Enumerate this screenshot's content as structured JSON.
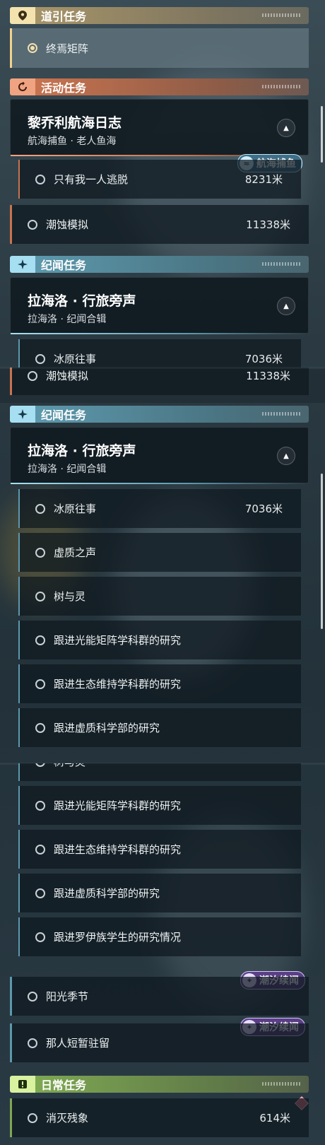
{
  "guide": {
    "category": "道引任务",
    "item": "终焉矩阵"
  },
  "activity": {
    "category": "活动任务",
    "title": "黎乔利航海日志",
    "subtitle": "航海捕鱼 · 老人鱼海",
    "tag": "航海捕鱼",
    "items": [
      {
        "label": "只有我一人逃脱",
        "distance": "8231米"
      },
      {
        "label": "潮蚀模拟",
        "distance": "11338米"
      }
    ]
  },
  "lore": {
    "category": "纪闻任务",
    "title": "拉海洛 · 行旅旁声",
    "subtitle": "拉海洛 · 纪闻合辑",
    "items": [
      {
        "label": "冰原往事",
        "distance": "7036米"
      },
      {
        "label": "虚质之声",
        "distance": ""
      },
      {
        "label": "树与灵",
        "distance": ""
      },
      {
        "label": "跟进光能矩阵学科群的研究",
        "distance": ""
      },
      {
        "label": "跟进生态维持学科群的研究",
        "distance": ""
      },
      {
        "label": "跟进虚质科学部的研究",
        "distance": ""
      },
      {
        "label": "跟进罗伊族学生的研究情况",
        "distance": ""
      }
    ],
    "tagged_items": [
      {
        "label": "阳光季节",
        "tag": "潮汐续闻"
      },
      {
        "label": "那人短暂驻留",
        "tag": "潮汐续闻"
      }
    ]
  },
  "daily": {
    "category": "日常任务",
    "items": [
      {
        "label": "消灭残象",
        "distance": "614米"
      }
    ]
  },
  "icons": {
    "guide": "map-pin-icon",
    "activity": "refresh-arrow-icon",
    "lore": "sparkle-icon",
    "daily": "exclamation-icon",
    "collapse": "chevron-up-icon"
  },
  "colors": {
    "guide": "#f3e2ad",
    "activity": "#f0a381",
    "lore": "#a6dff2",
    "daily": "#d8f2a0"
  }
}
